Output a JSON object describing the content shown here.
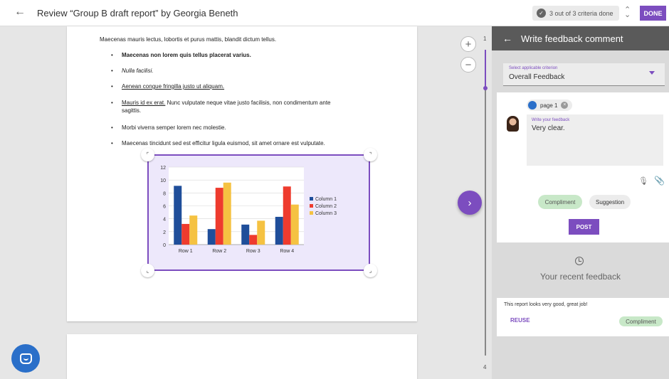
{
  "header": {
    "title": "Review “Group B draft report” by Georgia Beneth",
    "criteria_status": "3 out of 3 criteria done",
    "done_label": "DONE"
  },
  "document": {
    "intro": "Maecenas mauris lectus, lobortis et purus mattis, blandit dictum tellus.",
    "bullets": {
      "b1": "Maecenas non lorem quis tellus placerat varius.",
      "b2": "Nulla facilisi.",
      "b3": "Aenean congue fringilla justo ut aliquam.",
      "b4_link": "Mauris id ex erat.",
      "b4_rest": " Nunc vulputate neque vitae justo facilisis, non condimentum ante",
      "b4_cont": "sagittis.",
      "b5": "Morbi viverra semper lorem nec molestie.",
      "b6": "Maecenas tincidunt sed est efficitur ligula euismod, sit amet ornare est vulputate."
    },
    "page_start": "1",
    "page_end": "4"
  },
  "zoom": {
    "in_label": "+",
    "out_label": "−"
  },
  "chart_data": {
    "type": "bar",
    "categories": [
      "Row 1",
      "Row 2",
      "Row 3",
      "Row 4"
    ],
    "series": [
      {
        "name": "Column 1",
        "values": [
          9.1,
          2.4,
          3.1,
          4.3
        ],
        "color": "#1f4e9a"
      },
      {
        "name": "Column 2",
        "values": [
          3.2,
          8.8,
          1.5,
          9.0
        ],
        "color": "#ee3b2e"
      },
      {
        "name": "Column 3",
        "values": [
          4.5,
          9.6,
          3.7,
          6.2
        ],
        "color": "#f5c242"
      }
    ],
    "yticks": [
      "0",
      "2",
      "4",
      "6",
      "8",
      "10",
      "12"
    ],
    "ylim": [
      0,
      12
    ],
    "grid": true,
    "legend": "right"
  },
  "feedback_panel": {
    "title": "Write feedback comment",
    "criterion_label": "Select applicable criterion",
    "criterion_value": "Overall Feedback",
    "page_chip": "page 1",
    "feedback_label": "Write your feedback",
    "feedback_text": "Very clear.",
    "tag_compliment": "Compliment",
    "tag_suggestion": "Suggestion",
    "post_label": "POST",
    "recent_title": "Your recent feedback",
    "recent_item_text": "This report looks very good, great job!",
    "reuse_label": "REUSE",
    "recent_item_tag": "Compliment"
  },
  "colors": {
    "accent": "#7c4dbf",
    "compliment": "#c8e8c8",
    "panel_header": "#5a5a5a"
  }
}
